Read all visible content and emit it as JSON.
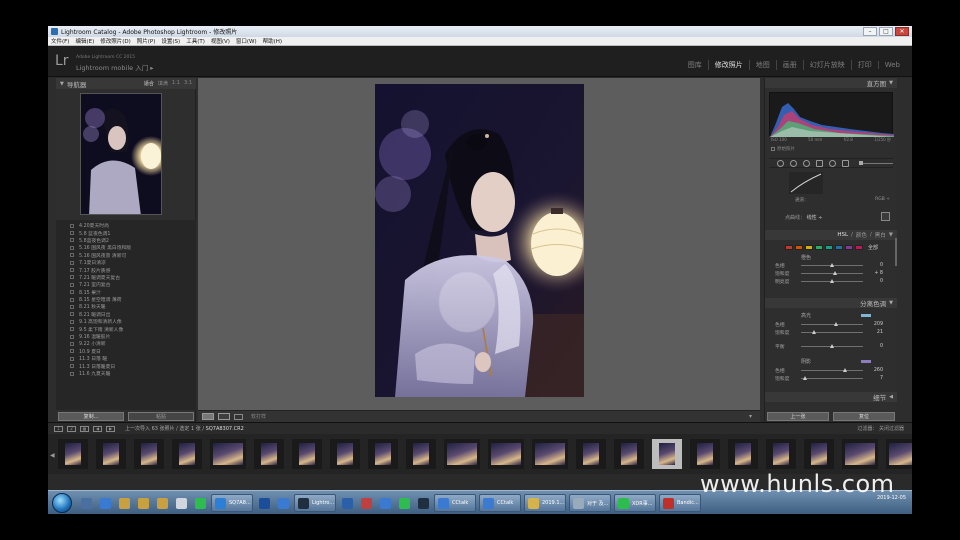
{
  "window": {
    "title": "Lightroom Catalog - Adobe Photoshop Lightroom - 修改照片",
    "min": "–",
    "max": "□",
    "close": "✕"
  },
  "menu": [
    "文件(F)",
    "编辑(E)",
    "修改照片(D)",
    "照片(P)",
    "设置(S)",
    "工具(T)",
    "视图(V)",
    "窗口(W)",
    "帮助(H)"
  ],
  "header": {
    "logo": "Lr",
    "catalog": "Adobe Lightroom CC 2015",
    "mobile": "Lightroom mobile 入门 ▸",
    "modules": [
      {
        "label": "图库",
        "active": false
      },
      {
        "label": "修改照片",
        "active": true
      },
      {
        "label": "地图",
        "active": false
      },
      {
        "label": "画册",
        "active": false
      },
      {
        "label": "幻灯片放映",
        "active": false
      },
      {
        "label": "打印",
        "active": false
      },
      {
        "label": "Web",
        "active": false
      }
    ]
  },
  "navigator": {
    "title": "导航器",
    "options": [
      "适合",
      "填满",
      "1:1",
      "3:1"
    ]
  },
  "presets": [
    "4.20夏天时尚",
    "5.8 蓝夜色调1",
    "5.8蓝夜色调2",
    "5.16 国风夜 黑白饱和版",
    "5.16 国风夜景 清新可",
    "7.1夏日清凉",
    "7.17 胶片质感",
    "7.21 暖调夏天复古",
    "7.21 室内复古",
    "8.15 果汁",
    "8.15 星空暗调 薄荷",
    "8.21 秋天暖",
    "8.21 暖调日出",
    "9.1 高饱和清新人像",
    "9.5 柔下雨 清新人像",
    "9.16 温暖胶片",
    "9.22 小清新",
    "10.9 夏日",
    "11.3 日落 暖",
    "11.3 日落暖夏日",
    "11.6 九夏天暖"
  ],
  "left_buttons": {
    "copy": "复制...",
    "paste": "粘贴"
  },
  "toolbar": {
    "softproof": "软打样",
    "caret": "▾"
  },
  "histogram": {
    "title": "直方图",
    "info": [
      "ISO 100",
      "50 mm",
      "f/2.8",
      "1/250 秒"
    ],
    "original": "原始照片"
  },
  "tone_curve": {
    "channel_label": "通道：",
    "channel_value": "RGB ÷",
    "point_label": "点曲线：",
    "point_value": "线性 ÷",
    "region_label": "区域",
    "region_value": "区域 ÷"
  },
  "hsl": {
    "tabs": [
      "HSL",
      "颜色",
      "黑白"
    ],
    "all": "全部",
    "section": "橙色",
    "sliders": [
      {
        "label": "色相",
        "value": "0",
        "pos": 0.5
      },
      {
        "label": "饱和度",
        "value": "+ 8",
        "pos": 0.56
      },
      {
        "label": "明亮度",
        "value": "0",
        "pos": 0.5
      }
    ],
    "swatches": [
      "#c0392b",
      "#d35400",
      "#d4ac0d",
      "#27ae60",
      "#16a085",
      "#2471a3",
      "#7d3c98",
      "#c2185b"
    ]
  },
  "split_toning": {
    "title": "分离色调",
    "highlights": "高光",
    "highlight_sliders": [
      {
        "label": "色相",
        "value": "209",
        "pos": 0.58
      },
      {
        "label": "饱和度",
        "value": "21",
        "pos": 0.21
      }
    ],
    "balance": {
      "label": "平衡",
      "value": "0",
      "pos": 0.5
    },
    "shadows": "阴影",
    "shadow_sliders": [
      {
        "label": "色相",
        "value": "260",
        "pos": 0.72
      },
      {
        "label": "饱和度",
        "value": "7",
        "pos": 0.07
      }
    ],
    "highlight_color": "#7fb6d6",
    "shadow_color": "#8d7cc0"
  },
  "detail": {
    "title": "细节"
  },
  "right_buttons": {
    "previous": "上一张",
    "reset": "复位"
  },
  "filmstrip": {
    "path_prefix": "上一次导入",
    "count": "63 张照片 / 选定 1 张 /",
    "file": "SQ7A8307.CR2",
    "filter_label": "过滤器：",
    "filter_value": "关闭过滤器"
  },
  "taskbar": {
    "apps": [
      {
        "label": "",
        "color": "#4a6fa0"
      },
      {
        "label": "",
        "color": "#3a7ad0"
      },
      {
        "label": "",
        "color": "#c9a040"
      },
      {
        "label": "",
        "color": "#c9a040"
      },
      {
        "label": "",
        "color": "#c9a040"
      },
      {
        "label": "",
        "color": "#cfd6df"
      },
      {
        "label": "",
        "color": "#2dbd4f"
      },
      {
        "label": "SQ7A8...",
        "color": "#2c7fd6"
      },
      {
        "label": "",
        "color": "#1b4e9a"
      },
      {
        "label": "",
        "color": "#3a7ad0"
      },
      {
        "label": "Lightro...",
        "color": "#1f2f3f"
      },
      {
        "label": "",
        "color": "#2b5fa8"
      },
      {
        "label": "",
        "color": "#c04040"
      },
      {
        "label": "",
        "color": "#3a7ad0"
      },
      {
        "label": "",
        "color": "#2dbd4f"
      },
      {
        "label": "",
        "color": "#1f2f3f"
      },
      {
        "label": "CCtalk",
        "color": "#3a7ad0"
      },
      {
        "label": "CCtalk",
        "color": "#3a7ad0"
      },
      {
        "label": "2019.1...",
        "color": "#d4b24c"
      },
      {
        "label": "对于 及...",
        "color": "#9ab"
      },
      {
        "label": "XDR事...",
        "color": "#2dbd4f"
      },
      {
        "label": "Bandic...",
        "color": "#c0302a"
      }
    ],
    "clock_time": "",
    "clock_date": "2019-12-05"
  },
  "watermark": "www.hunls.com"
}
